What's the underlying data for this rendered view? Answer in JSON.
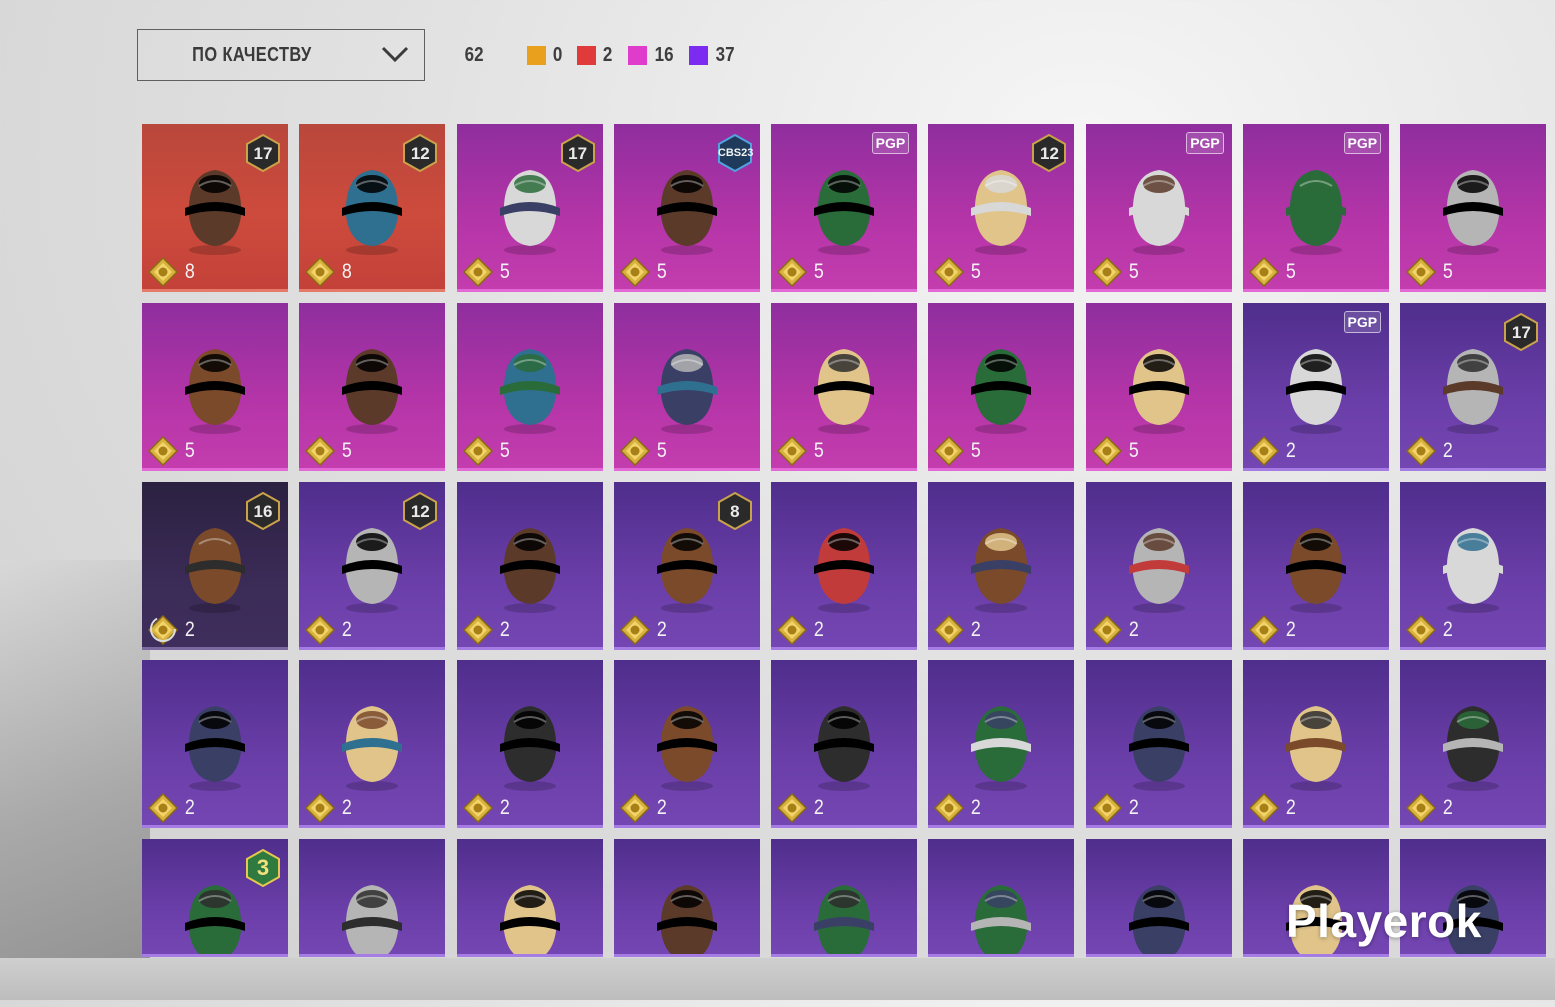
{
  "colors": {
    "orange": "#e9a01d",
    "red": "#e13a3a",
    "pink": "#e03ccb",
    "purple": "#7b2cf0"
  },
  "sort": {
    "label": "ПО КАЧЕСТВУ",
    "icon": "chevron-down-icon"
  },
  "summary": {
    "total": "62",
    "counts": [
      {
        "color": "#e9a01d",
        "value": "0"
      },
      {
        "color": "#e13a3a",
        "value": "2"
      },
      {
        "color": "#e03ccb",
        "value": "16"
      },
      {
        "color": "#7b2cf0",
        "value": "37"
      }
    ]
  },
  "items": [
    {
      "quality": "red",
      "art": "dragon-mask",
      "badge": "17",
      "price": "8"
    },
    {
      "quality": "red",
      "art": "white-wig",
      "badge": "12",
      "price": "8"
    },
    {
      "quality": "pink",
      "art": "cap-blonde-hair",
      "badge": "17",
      "price": "5"
    },
    {
      "quality": "pink",
      "art": "cat-headphones",
      "badge": "CBS23",
      "price": "5"
    },
    {
      "quality": "pink",
      "art": "pattern-cap",
      "tag": "PGP",
      "price": "5"
    },
    {
      "quality": "pink",
      "art": "orange-hair",
      "badge": "12",
      "price": "5"
    },
    {
      "quality": "pink",
      "art": "llama-mask",
      "tag": "PGP",
      "price": "5"
    },
    {
      "quality": "pink",
      "art": "panda-mask",
      "tag": "PGP",
      "price": "5"
    },
    {
      "quality": "pink",
      "art": "cat-helmet",
      "price": "5"
    },
    {
      "quality": "pink",
      "art": "robot-mask",
      "price": "5"
    },
    {
      "quality": "pink",
      "art": "shark-hood",
      "price": "5"
    },
    {
      "quality": "pink",
      "art": "rooster-mask",
      "price": "5"
    },
    {
      "quality": "pink",
      "art": "armored-mask",
      "price": "5"
    },
    {
      "quality": "pink",
      "art": "moto-helmet",
      "price": "5"
    },
    {
      "quality": "pink",
      "art": "wolf-mask",
      "price": "5"
    },
    {
      "quality": "pink",
      "art": "bear-mask",
      "price": "5"
    },
    {
      "quality": "purple",
      "art": "heart-headband",
      "tag": "PGP",
      "price": "2"
    },
    {
      "quality": "purple",
      "art": "tiara-hair",
      "badge": "17",
      "price": "2"
    },
    {
      "quality": "dark",
      "art": "beanie-goggles",
      "badge": "16",
      "price": "2",
      "locked": true
    },
    {
      "quality": "purple",
      "art": "bunny-helmet",
      "badge": "12",
      "price": "2"
    },
    {
      "quality": "purple",
      "art": "officer-caps",
      "price": "2"
    },
    {
      "quality": "purple",
      "art": "green-mask-hair",
      "badge": "8",
      "price": "2"
    },
    {
      "quality": "purple",
      "art": "white-cap",
      "price": "2"
    },
    {
      "quality": "purple",
      "art": "goggles-hair",
      "price": "2"
    },
    {
      "quality": "purple",
      "art": "horned-hat",
      "price": "2"
    },
    {
      "quality": "purple",
      "art": "blonde-wavy-hair",
      "price": "2"
    },
    {
      "quality": "purple",
      "art": "grey-cap",
      "price": "2"
    },
    {
      "quality": "purple",
      "art": "football-helmet",
      "price": "2"
    },
    {
      "quality": "purple",
      "art": "scarecrow-hat",
      "price": "2"
    },
    {
      "quality": "purple",
      "art": "black-mask",
      "price": "2"
    },
    {
      "quality": "purple",
      "art": "shark-hat",
      "price": "2"
    },
    {
      "quality": "purple",
      "art": "red-beret",
      "price": "2"
    },
    {
      "quality": "purple",
      "art": "black-top-hat",
      "price": "2"
    },
    {
      "quality": "purple",
      "art": "red-top-hat",
      "price": "2"
    },
    {
      "quality": "purple",
      "art": "white-shark-hat",
      "price": "2"
    },
    {
      "quality": "purple",
      "art": "flower-crown-purple",
      "price": "2"
    },
    {
      "quality": "purple",
      "art": "flower-crown-white",
      "badge": "3"
    },
    {
      "quality": "purple",
      "art": "cake-hat"
    },
    {
      "quality": "purple",
      "art": "burger-hat"
    },
    {
      "quality": "purple",
      "art": "headlamp"
    },
    {
      "quality": "purple",
      "art": "navy-cap"
    },
    {
      "quality": "purple",
      "art": "black-gold-cap"
    },
    {
      "quality": "purple",
      "art": "blue-cap"
    },
    {
      "quality": "purple",
      "art": "red-fedora"
    },
    {
      "quality": "purple",
      "art": "net-helmet"
    }
  ],
  "watermark": "Playerok"
}
